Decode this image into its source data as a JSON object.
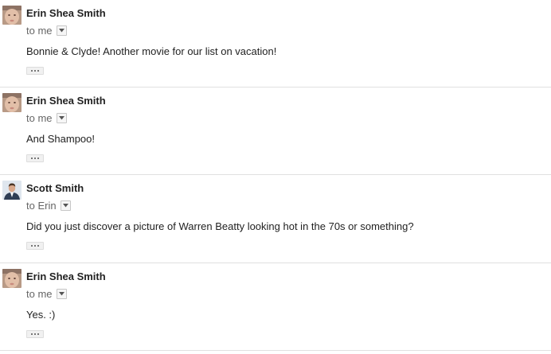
{
  "messages": [
    {
      "sender": "Erin Shea Smith",
      "recipient": "to me",
      "body": "Bonnie & Clyde! Another movie for our list on vacation!",
      "avatar_icon": "baby-avatar-icon"
    },
    {
      "sender": "Erin Shea Smith",
      "recipient": "to me",
      "body": "And Shampoo!",
      "avatar_icon": "baby-avatar-icon"
    },
    {
      "sender": "Scott Smith",
      "recipient": "to Erin",
      "body": "Did you just discover a picture of Warren Beatty looking hot in the 70s or something?",
      "avatar_icon": "man-avatar-icon"
    },
    {
      "sender": "Erin Shea Smith",
      "recipient": "to me",
      "body": "Yes. :)",
      "avatar_icon": "baby-avatar-icon"
    }
  ],
  "icons": {
    "details_toggle": "chevron-down-icon",
    "show_trimmed": "ellipsis-icon"
  },
  "colors": {
    "sender_text": "#222222",
    "recipient_text": "#666666",
    "divider": "#e0e0e0"
  }
}
